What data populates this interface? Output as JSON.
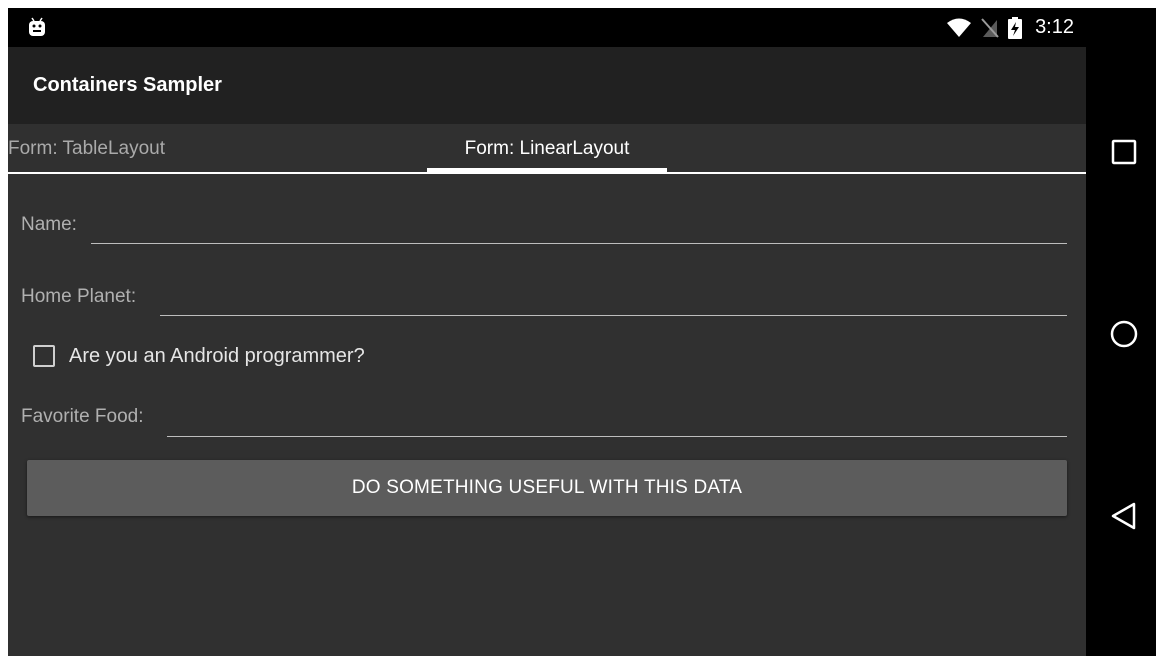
{
  "status_bar": {
    "time": "3:12",
    "icons": [
      "android-icon",
      "wifi-icon",
      "no-sim-icon",
      "battery-charging-icon"
    ]
  },
  "app_bar": {
    "title": "Containers Sampler"
  },
  "tabs": [
    {
      "label": "Form: TableLayout",
      "selected": false
    },
    {
      "label": "Form: LinearLayout",
      "selected": true
    }
  ],
  "form": {
    "name": {
      "label": "Name:",
      "value": ""
    },
    "home_planet": {
      "label": "Home Planet:",
      "value": ""
    },
    "android_programmer": {
      "label": "Are you an Android programmer?",
      "checked": false
    },
    "favorite_food": {
      "label": "Favorite Food:",
      "value": ""
    },
    "submit_label": "DO SOMETHING USEFUL WITH THIS DATA"
  },
  "nav_bar": {
    "buttons": [
      "recents-square-icon",
      "home-circle-icon",
      "back-triangle-icon"
    ]
  },
  "colors": {
    "background": "#303030",
    "app_bar": "#212121",
    "button": "#5c5c5c",
    "text_primary": "#ffffff",
    "text_secondary": "#b0b0b0"
  }
}
